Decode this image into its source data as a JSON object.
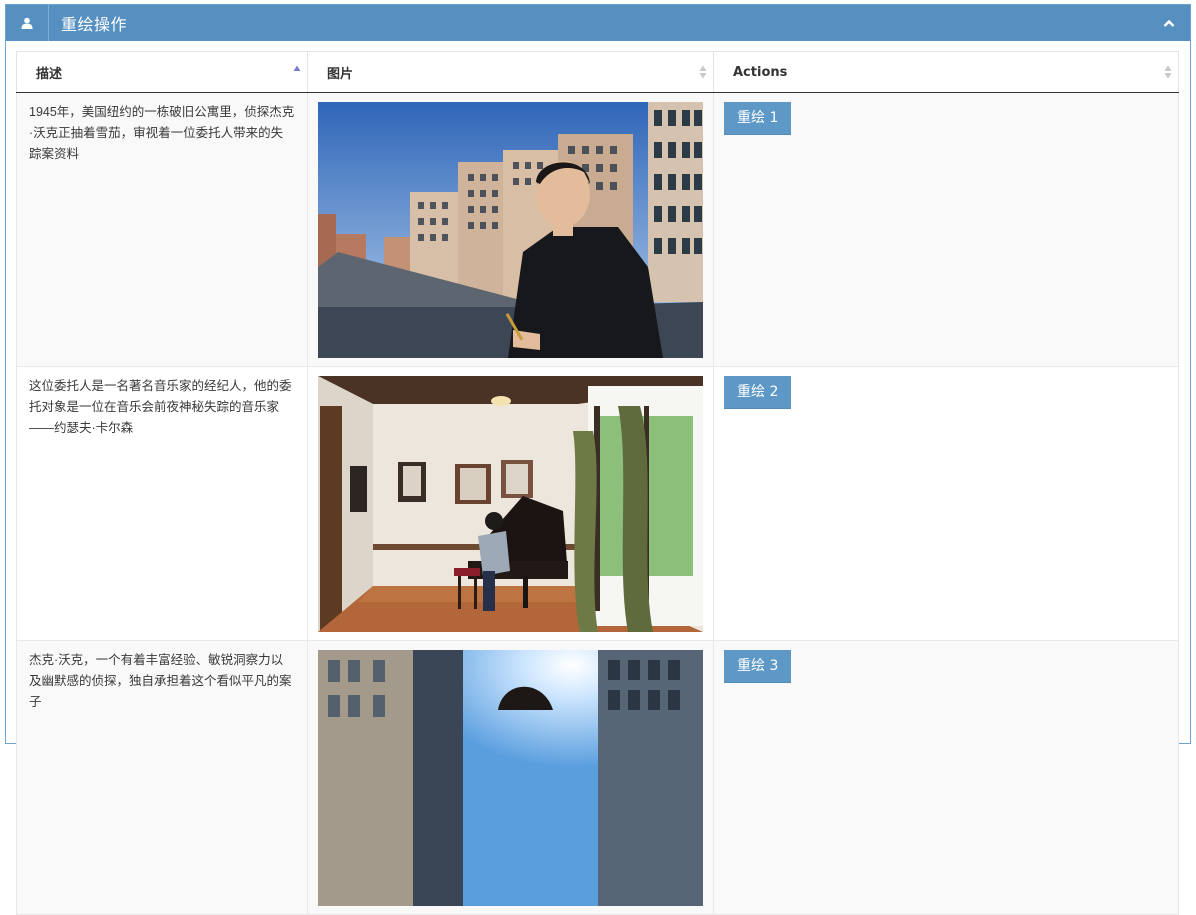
{
  "panel": {
    "title": "重绘操作",
    "user_icon": "user-icon",
    "collapse_icon": "chevron-up-icon"
  },
  "table": {
    "headers": [
      "描述",
      "图片",
      "Actions"
    ],
    "rows": [
      {
        "description": "1945年，美国纽约的一栋破旧公寓里，侦探杰克·沃克正抽着雪茄，审视着一位委托人带来的失踪案资料",
        "image_alt": "anime-style detective in black suit on rooftop with buildings",
        "button": "重绘 1"
      },
      {
        "description": "这位委托人是一名著名音乐家的经纪人，他的委托对象是一位在音乐会前夜神秘失踪的音乐家——约瑟夫·卡尔森",
        "image_alt": "man playing grand piano in room with framed portraits",
        "button": "重绘 2"
      },
      {
        "description": "杰克·沃克，一个有着丰富经验、敏锐洞察力以及幽默感的侦探，独自承担着这个看似平凡的案子",
        "image_alt": "detective among city buildings with sun flare",
        "button": "重绘 3"
      }
    ]
  },
  "colors": {
    "header_bg": "#5590c1",
    "button_bg": "#5d98c6",
    "sort_active": "#7b7bd6",
    "sort_inactive": "#c8c8c8"
  }
}
